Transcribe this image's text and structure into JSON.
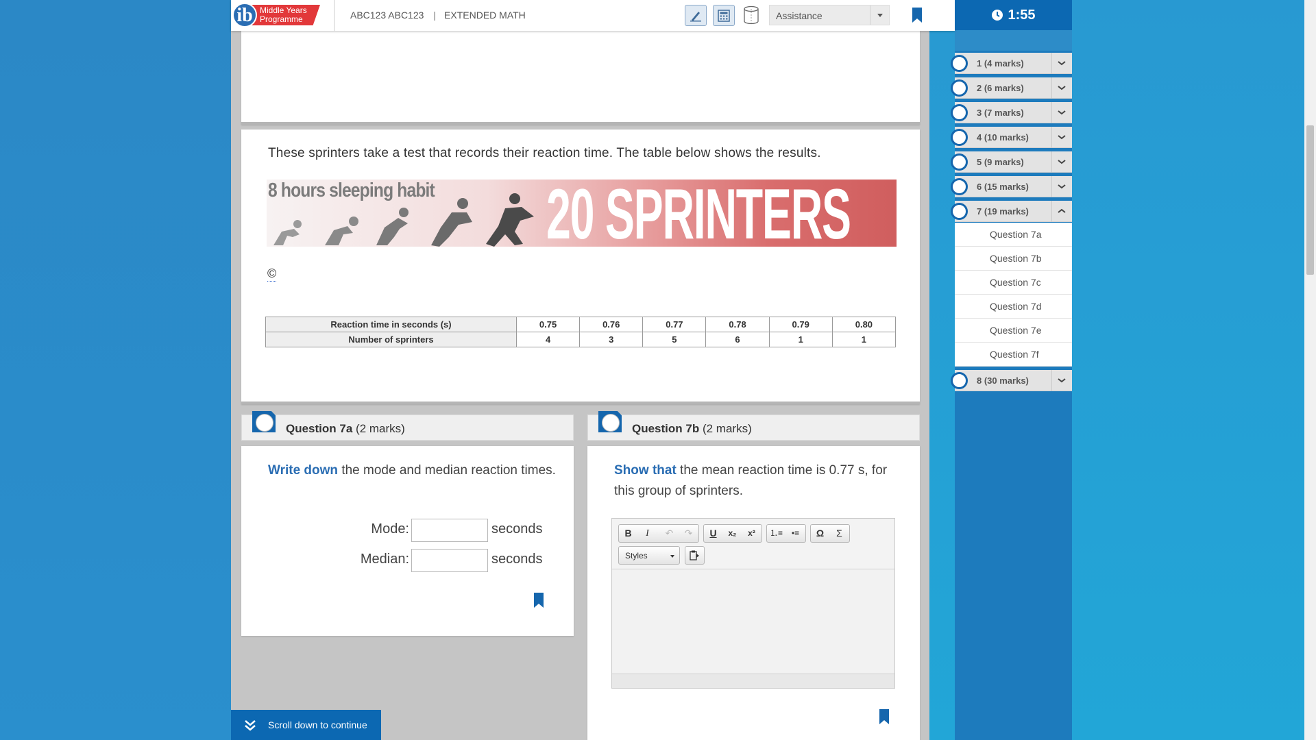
{
  "header": {
    "logo_line1": "Middle Years",
    "logo_line2": "Programme",
    "candidate": "ABC123 ABC123",
    "subject": "EXTENDED MATH",
    "assistance_label": "Assistance",
    "timer": "1:55"
  },
  "stem": {
    "text": "These sprinters take a test that records their reaction time. The table below shows the results.",
    "banner_habit": "8 hours sleeping habit",
    "banner_title": "20 SPRINTERS",
    "copyright": "©",
    "table": {
      "row1_header": "Reaction time in seconds (s)",
      "row2_header": "Number of sprinters",
      "times": [
        "0.75",
        "0.76",
        "0.77",
        "0.78",
        "0.79",
        "0.80"
      ],
      "counts": [
        "4",
        "3",
        "5",
        "6",
        "1",
        "1"
      ]
    }
  },
  "q7a": {
    "title": "Question 7a",
    "marks": "(2 marks)",
    "command": "Write down",
    "text": " the mode and median reaction times.",
    "mode_label": "Mode:",
    "median_label": "Median:",
    "mode_value": "",
    "median_value": "",
    "unit": "seconds"
  },
  "q7b": {
    "title": "Question 7b",
    "marks": "(2 marks)",
    "command": "Show that",
    "text": " the mean reaction time is 0.77 s, for this group of sprinters.",
    "styles_label": "Styles"
  },
  "scroll_label": "Scroll down to continue",
  "nav": {
    "items": [
      {
        "label": "1 (4 marks)"
      },
      {
        "label": "2 (6 marks)"
      },
      {
        "label": "3 (7 marks)"
      },
      {
        "label": "4 (10 marks)"
      },
      {
        "label": "5 (9 marks)"
      },
      {
        "label": "6 (15 marks)"
      },
      {
        "label": "7 (19 marks)"
      },
      {
        "label": "8 (30 marks)"
      }
    ],
    "subitems": [
      {
        "label": "Question 7a"
      },
      {
        "label": "Question 7b"
      },
      {
        "label": "Question 7c"
      },
      {
        "label": "Question 7d"
      },
      {
        "label": "Question 7e"
      },
      {
        "label": "Question 7f"
      }
    ]
  },
  "colors": {
    "accent": "#0c68b2",
    "command_text": "#2a6db3",
    "logo_red": "#e2383a"
  }
}
